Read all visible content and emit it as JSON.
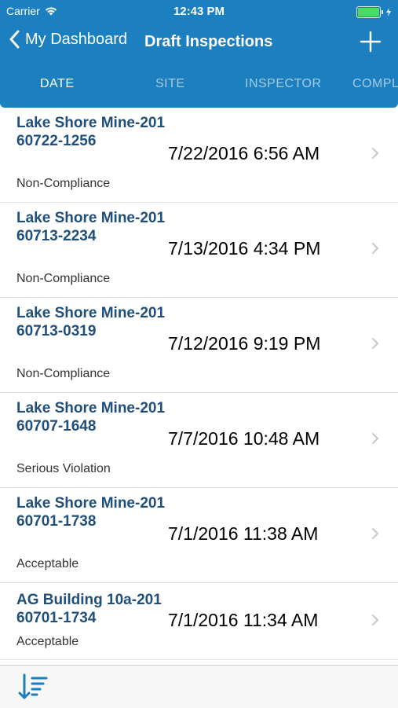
{
  "status_bar": {
    "carrier": "Carrier",
    "time": "12:43 PM",
    "battery_color": "#4cd964"
  },
  "nav": {
    "back_label": "My Dashboard",
    "title": "Draft Inspections",
    "back_icon": "chevron-left-icon",
    "add_icon": "plus-icon"
  },
  "tabs": [
    {
      "label": "DATE",
      "active": true
    },
    {
      "label": "SITE",
      "active": false
    },
    {
      "label": "INSPECTOR",
      "active": false
    },
    {
      "label": "COMPL",
      "active": false
    }
  ],
  "inspections": [
    {
      "title": "Lake Shore Mine-20160722-1256",
      "status": "Non-Compliance",
      "date": "7/22/2016 6:56 AM"
    },
    {
      "title": "Lake Shore Mine-20160713-2234",
      "status": "Non-Compliance",
      "date": "7/13/2016 4:34 PM"
    },
    {
      "title": "Lake Shore Mine-20160713-0319",
      "status": "Non-Compliance",
      "date": "7/12/2016 9:19 PM"
    },
    {
      "title": "Lake Shore Mine-20160707-1648",
      "status": "Serious Violation",
      "date": "7/7/2016 10:48 AM"
    },
    {
      "title": "Lake Shore Mine-20160701-1738",
      "status": "Acceptable",
      "date": "7/1/2016 11:38 AM"
    },
    {
      "title": "AG Building 10a-20160701-1734",
      "status": "Acceptable",
      "date": "7/1/2016 11:34 AM"
    }
  ],
  "colors": {
    "accent": "#1b7fc0",
    "title_text": "#1f4f7a"
  },
  "toolbar": {
    "sort_icon": "sort-descending-icon"
  }
}
